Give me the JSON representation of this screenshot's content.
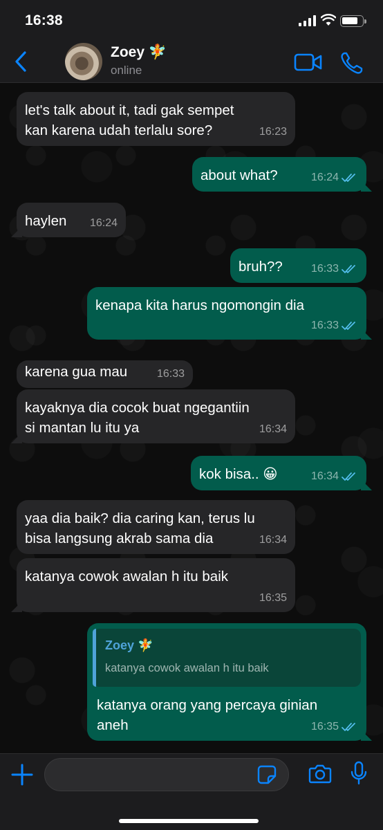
{
  "status_bar": {
    "time": "16:38"
  },
  "header": {
    "contact_name": "Zoey 🧚",
    "contact_status": "online",
    "icons": [
      "back-chevron-icon",
      "video-call-icon",
      "phone-call-icon"
    ]
  },
  "messages": [
    {
      "dir": "in",
      "text": "let's talk about it, tadi gak sempet\nkan karena udah terlalu sore?",
      "time": "16:23"
    },
    {
      "dir": "out",
      "text": "about what?",
      "time": "16:24",
      "status": "read"
    },
    {
      "dir": "in",
      "text": "haylen",
      "time": "16:24"
    },
    {
      "dir": "out",
      "text": "bruh??",
      "time": "16:33",
      "status": "read"
    },
    {
      "dir": "out",
      "text": "kenapa kita harus ngomongin dia",
      "time": "16:33",
      "status": "read"
    },
    {
      "dir": "in",
      "text": "karena gua mau",
      "time": "16:33"
    },
    {
      "dir": "in",
      "text": "kayaknya dia cocok buat ngegantiin\nsi mantan lu itu ya",
      "time": "16:34"
    },
    {
      "dir": "out",
      "text": "kok bisa.. 😀",
      "time": "16:34",
      "status": "read"
    },
    {
      "dir": "in",
      "text": "yaa dia baik? dia caring kan, terus lu\nbisa langsung akrab sama dia",
      "time": "16:34"
    },
    {
      "dir": "in",
      "text": "katanya cowok awalan h itu baik",
      "time": "16:35"
    },
    {
      "dir": "out",
      "text": "katanya orang yang percaya ginian\naneh",
      "time": "16:35",
      "status": "read",
      "reply_to": {
        "name": "Zoey 🧚",
        "text": "katanya cowok awalan h itu baik"
      }
    }
  ],
  "composer": {
    "placeholder": "",
    "icons": [
      "plus-icon",
      "sticker-icon",
      "camera-icon",
      "microphone-icon"
    ]
  },
  "colors": {
    "accent": "#0a84ff",
    "outgoing_bubble": "#025c4c",
    "incoming_bubble": "#262628",
    "read_ticks": "#53bdeb",
    "reply_name": "#4fa3d9"
  }
}
